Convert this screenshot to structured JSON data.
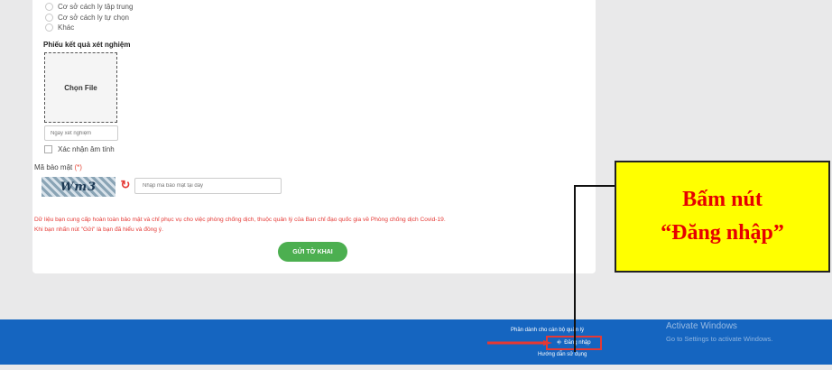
{
  "form": {
    "options": [
      "Cơ sở cách ly tập trung",
      "Cơ sở cách ly tự chọn",
      "Khác"
    ],
    "test_result_label": "Phiếu kết quả xét nghiệm",
    "choose_file": "Chọn File",
    "test_date_placeholder": "Ngày xét nghiệm",
    "negative_confirm": "Xác nhận âm tính",
    "captcha_label": "Mã bảo mật",
    "captcha_required": "(*)",
    "captcha_text": "Wm3",
    "captcha_placeholder": "Nhập mã bảo mật tại đây",
    "disclaimer_line1": "Dữ liệu bạn cung cấp hoàn toàn bảo mật và chỉ phục vụ cho việc phòng chống dịch, thuộc quản lý của Ban chỉ đạo quốc gia về Phòng chống dịch Covid-19.",
    "disclaimer_line2": "Khi bạn nhấn nút \"Gửi\" là bạn đã hiểu và đồng ý.",
    "submit": "GỬI TỜ KHAI"
  },
  "footer": {
    "staff_section": "Phần dành cho cán bộ quản lý",
    "login": "Đăng nhập",
    "guide": "Hướng dẫn sử dụng"
  },
  "watermark": {
    "title": "Activate Windows",
    "subtitle": "Go to Settings to activate Windows."
  },
  "callout": {
    "line1": "Bấm nút",
    "line2": "“Đăng nhập”"
  },
  "colors": {
    "footer_blue": "#1565c0",
    "submit_green": "#4caf50",
    "warning_red": "#e53935",
    "callout_yellow": "#ffff00"
  }
}
